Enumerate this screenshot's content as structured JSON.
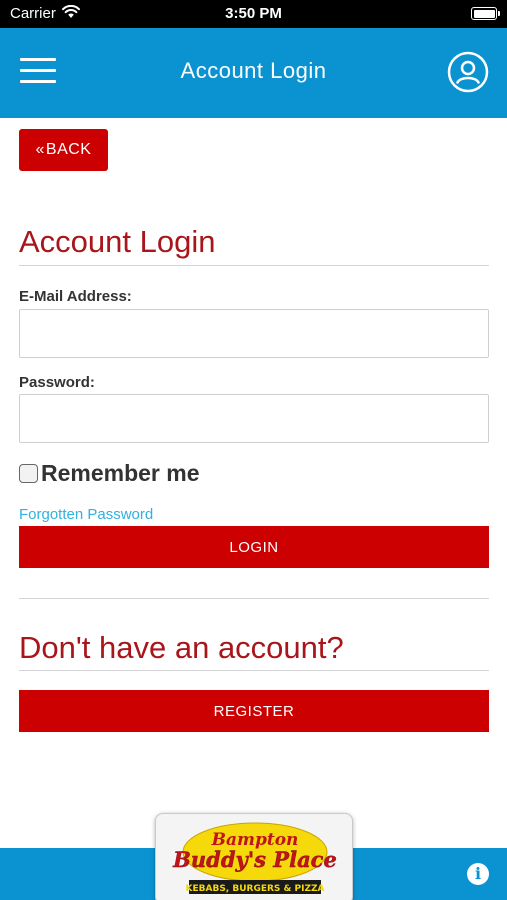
{
  "status_bar": {
    "carrier": "Carrier",
    "time": "3:50 PM"
  },
  "header": {
    "title": "Account Login"
  },
  "back_button": {
    "label": "BACK"
  },
  "login_section": {
    "title": "Account Login",
    "email_label": "E-Mail Address:",
    "email_value": "",
    "password_label": "Password:",
    "password_value": "",
    "remember_label": "Remember me",
    "remember_checked": false,
    "forgot_link": "Forgotten Password",
    "login_button": "LOGIN"
  },
  "register_section": {
    "title": "Don't have an account?",
    "register_button": "REGISTER"
  },
  "logo": {
    "line1": "Bampton",
    "line2": "Buddy's Place",
    "tagline": "KEBABS, BURGERS & PIZZA"
  },
  "colors": {
    "header_blue": "#0b93d1",
    "button_red": "#cc0000",
    "title_red": "#a8161b",
    "link_blue": "#2fb2df",
    "logo_yellow": "#f5d90a"
  },
  "icons": {
    "menu": "hamburger-menu-icon",
    "account": "user-circle-icon",
    "info": "info-icon",
    "back": "double-chevron-left-icon",
    "wifi": "wifi-icon",
    "battery": "battery-icon"
  }
}
